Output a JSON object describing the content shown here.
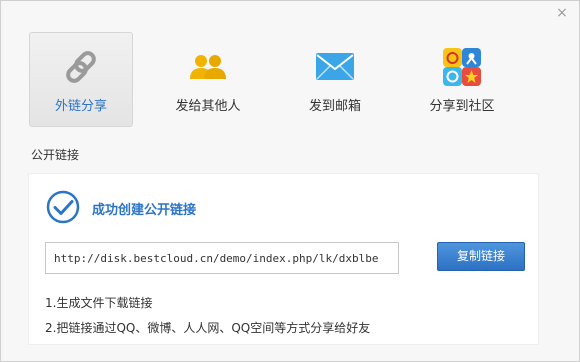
{
  "dialog": {
    "close_glyph": "×"
  },
  "tabs": [
    {
      "label": "外链分享",
      "icon": "link-icon",
      "active": true
    },
    {
      "label": "发给其他人",
      "icon": "users-icon",
      "active": false
    },
    {
      "label": "发到邮箱",
      "icon": "mail-icon",
      "active": false
    },
    {
      "label": "分享到社区",
      "icon": "social-community-icon",
      "active": false
    }
  ],
  "section_title": "公开链接",
  "success": {
    "text": "成功创建公开链接",
    "icon": "check-circle-icon"
  },
  "link": {
    "value": "http://disk.bestcloud.cn/demo/index.php/lk/dxblbe"
  },
  "copy_button": {
    "label": "复制链接"
  },
  "notes": [
    "1.生成文件下载链接",
    "2.把链接通过QQ、微博、人人网、QQ空间等方式分享给好友"
  ],
  "colors": {
    "accent": "#2b74c6",
    "button_bg": "#3a82d1",
    "users_icon": "#f0b400",
    "mail_icon": "#3aa6e8"
  }
}
